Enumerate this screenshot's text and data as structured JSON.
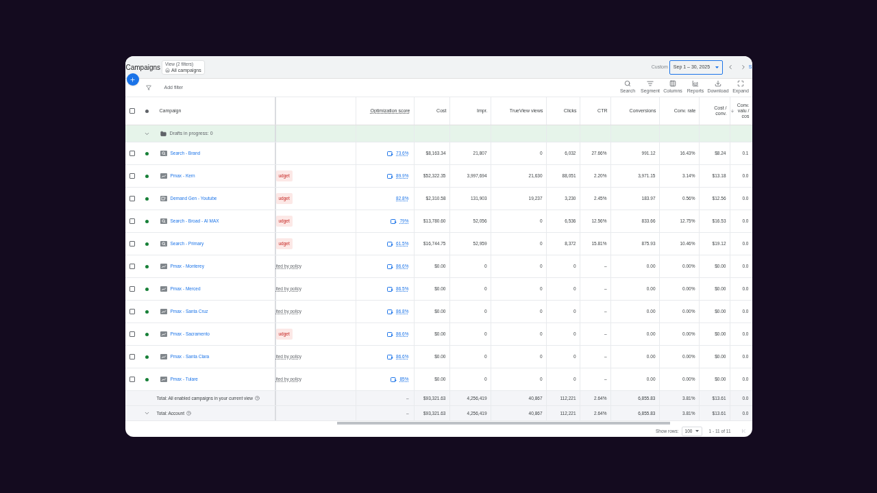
{
  "header": {
    "title": "Campaigns",
    "view_label": "View (2 filters)",
    "view_value": "All campaigns",
    "date_label": "Custom",
    "date_range": "Sep 1 – 30, 2025",
    "cut_link": "S"
  },
  "toolbar": {
    "add_filter": "Add filter",
    "tools": [
      {
        "kind": "search",
        "label": "Search"
      },
      {
        "kind": "segment",
        "label": "Segment"
      },
      {
        "kind": "columns",
        "label": "Columns"
      },
      {
        "kind": "reports",
        "label": "Reports"
      },
      {
        "kind": "download",
        "label": "Download"
      },
      {
        "kind": "expand",
        "label": "Expand"
      }
    ]
  },
  "table": {
    "campaign_header": "Campaign",
    "header_checked": false,
    "score_header": "Optimization score",
    "columns": [
      "Cost",
      "Impr.",
      "TrueView views",
      "Clicks",
      "CTR",
      "Conversions",
      "Conv. rate",
      "Cost / conv.",
      "Conv. valu / cos"
    ],
    "drafts": {
      "label": "Drafts in progress: 0",
      "expanded": true
    },
    "rows": [
      {
        "checked": false,
        "enabled": true,
        "kind": "search",
        "name": "Search - Brand",
        "score": "73.6%",
        "score_icon": true,
        "cells": [
          "$8,163.34",
          "21,807",
          "0",
          "6,032",
          "27.66%",
          "991.12",
          "16.43%",
          "$8.24",
          "0.1"
        ]
      },
      {
        "checked": false,
        "enabled": true,
        "kind": "pmax",
        "name": "Pmax - Kern",
        "status": {
          "kind": "budget",
          "text": "udget"
        },
        "score": "89.9%",
        "score_icon": true,
        "cells": [
          "$52,322.35",
          "3,997,694",
          "21,630",
          "88,051",
          "2.20%",
          "3,971.15",
          "3.14%",
          "$13.18",
          "0.0"
        ]
      },
      {
        "checked": false,
        "enabled": true,
        "kind": "demand_gen",
        "name": "Demand Gen - Youtube",
        "status": {
          "kind": "budget",
          "text": "udget"
        },
        "score": "82.8%",
        "score_icon": false,
        "cells": [
          "$2,310.58",
          "131,903",
          "19,237",
          "3,230",
          "2.45%",
          "183.97",
          "0.56%",
          "$12.56",
          "0.0"
        ]
      },
      {
        "checked": false,
        "enabled": true,
        "kind": "search",
        "name": "Search - Broad - AI MAX",
        "status": {
          "kind": "budget",
          "text": "udget"
        },
        "score": "79%",
        "score_icon": true,
        "cells": [
          "$13,780.60",
          "52,056",
          "0",
          "6,536",
          "12.56%",
          "833.66",
          "12.75%",
          "$16.53",
          "0.0"
        ]
      },
      {
        "checked": false,
        "enabled": true,
        "kind": "search",
        "name": "Search - Primary",
        "status": {
          "kind": "budget",
          "text": "udget"
        },
        "score": "61.5%",
        "score_icon": true,
        "cells": [
          "$16,744.75",
          "52,959",
          "0",
          "8,372",
          "15.81%",
          "875.93",
          "10.46%",
          "$19.12",
          "0.0"
        ]
      },
      {
        "checked": false,
        "enabled": true,
        "kind": "pmax",
        "name": "Pmax - Monterey",
        "status": {
          "kind": "policy",
          "text": "ited by policy"
        },
        "score": "86.6%",
        "score_icon": true,
        "cells": [
          "$0.00",
          "0",
          "0",
          "0",
          "–",
          "0.00",
          "0.00%",
          "$0.00",
          "0.0"
        ]
      },
      {
        "checked": false,
        "enabled": true,
        "kind": "pmax",
        "name": "Pmax - Merced",
        "status": {
          "kind": "policy",
          "text": "ited by policy"
        },
        "score": "86.5%",
        "score_icon": true,
        "cells": [
          "$0.00",
          "0",
          "0",
          "0",
          "–",
          "0.00",
          "0.00%",
          "$0.00",
          "0.0"
        ]
      },
      {
        "checked": false,
        "enabled": true,
        "kind": "pmax",
        "name": "Pmax - Santa Cruz",
        "status": {
          "kind": "policy",
          "text": "ited by policy"
        },
        "score": "86.8%",
        "score_icon": true,
        "cells": [
          "$0.00",
          "0",
          "0",
          "0",
          "–",
          "0.00",
          "0.00%",
          "$0.00",
          "0.0"
        ]
      },
      {
        "checked": false,
        "enabled": true,
        "kind": "pmax",
        "name": "Pmax - Sacramento",
        "status": {
          "kind": "budget",
          "text": "udget"
        },
        "score": "86.6%",
        "score_icon": true,
        "cells": [
          "$0.00",
          "0",
          "0",
          "0",
          "–",
          "0.00",
          "0.00%",
          "$0.00",
          "0.0"
        ]
      },
      {
        "checked": false,
        "enabled": true,
        "kind": "pmax",
        "name": "Pmax - Santa Clara",
        "status": {
          "kind": "policy",
          "text": "ited by policy"
        },
        "score": "86.6%",
        "score_icon": true,
        "cells": [
          "$0.00",
          "0",
          "0",
          "0",
          "–",
          "0.00",
          "0.00%",
          "$0.00",
          "0.0"
        ]
      },
      {
        "checked": false,
        "enabled": true,
        "kind": "pmax",
        "name": "Pmax - Tulare",
        "status": {
          "kind": "policy",
          "text": "ited by policy"
        },
        "score": "85%",
        "score_icon": true,
        "cells": [
          "$0.00",
          "0",
          "0",
          "0",
          "–",
          "0.00",
          "0.00%",
          "$0.00",
          "0.0"
        ]
      }
    ],
    "totals": [
      {
        "label": "Total: All enabled campaigns in your current view",
        "expandable": false,
        "score": "–",
        "cells": [
          "$93,321.63",
          "4,256,419",
          "40,867",
          "112,221",
          "2.64%",
          "6,855.83",
          "3.81%",
          "$13.61",
          "0.0"
        ]
      },
      {
        "label": "Total: Account",
        "expandable": true,
        "score": "–",
        "cells": [
          "$93,321.63",
          "4,256,419",
          "40,867",
          "112,221",
          "2.64%",
          "6,855.83",
          "3.81%",
          "$13.61",
          "0.0"
        ]
      }
    ]
  },
  "footer": {
    "show_rows_label": "Show rows:",
    "rows_value": "100",
    "range": "1 - 11 of 11"
  }
}
